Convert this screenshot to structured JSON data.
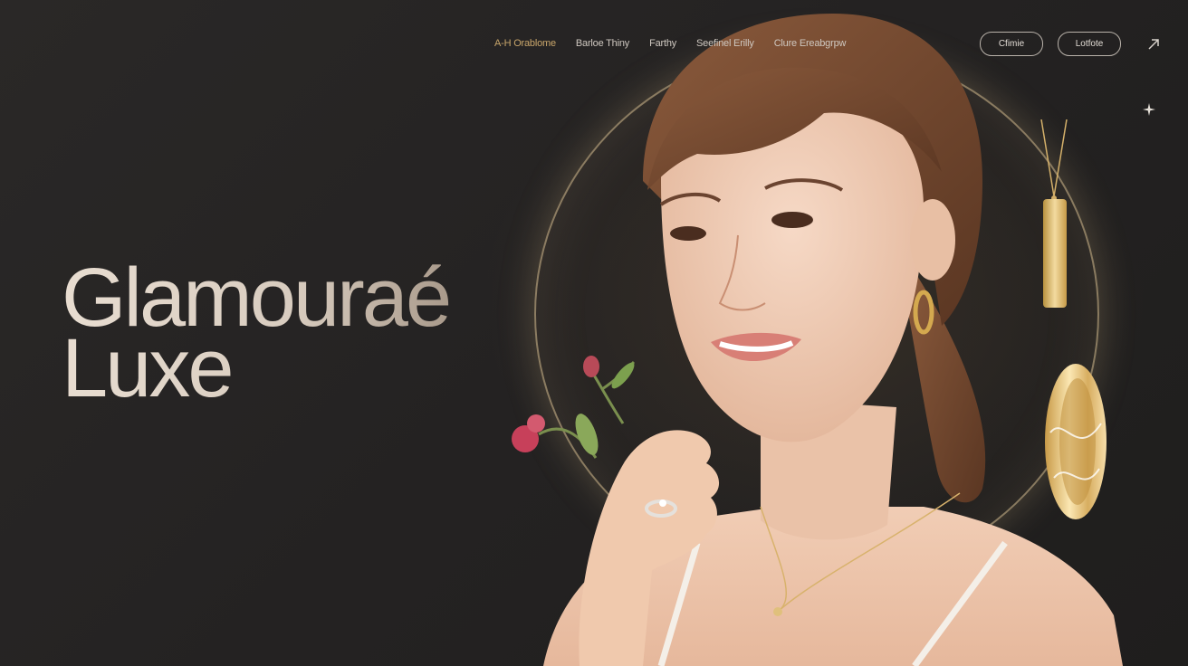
{
  "nav": {
    "items": [
      {
        "label": "A-H Orablome",
        "active": true
      },
      {
        "label": "Barloe Thiny",
        "active": false
      },
      {
        "label": "Farthy",
        "active": false
      },
      {
        "label": "Seefinel Erilly",
        "active": false
      },
      {
        "label": "Clure Ereabgrpw",
        "active": false
      }
    ]
  },
  "header": {
    "button_1": "Cfimie",
    "button_2": "Lotfote"
  },
  "hero": {
    "line_1": "Glamouraé",
    "line_2": "Luxe"
  },
  "colors": {
    "background": "#262424",
    "accent_gold": "#c9a66b",
    "text_light": "#e8ddd1"
  },
  "icons": {
    "arrow": "arrow-up-right-icon",
    "sparkle": "sparkle-icon"
  }
}
